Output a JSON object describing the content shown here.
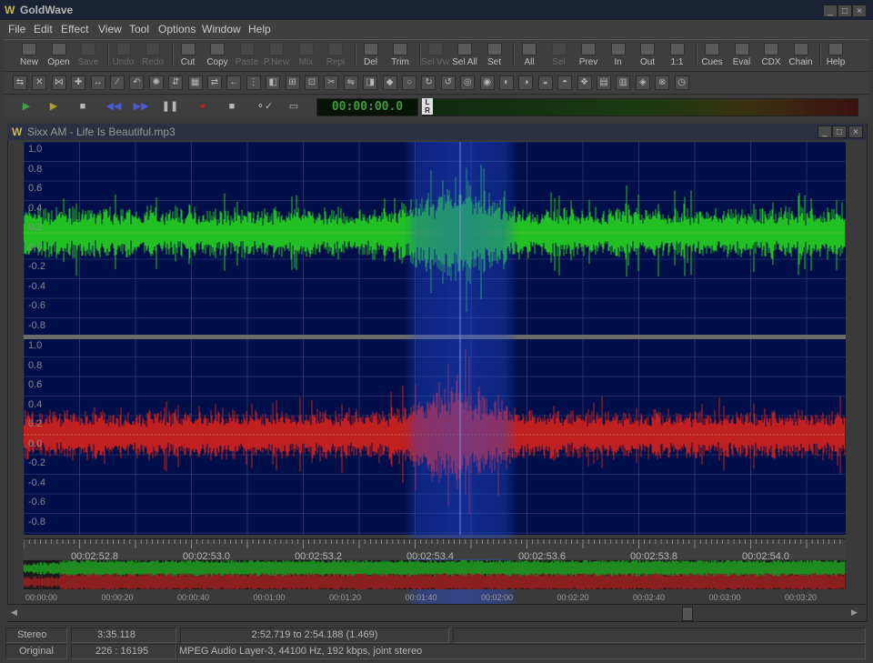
{
  "app": {
    "title": "GoldWave"
  },
  "menu": [
    "File",
    "Edit",
    "Effect",
    "View",
    "Tool",
    "Options",
    "Window",
    "Help"
  ],
  "toolbar": [
    {
      "label": "New",
      "enabled": true
    },
    {
      "label": "Open",
      "enabled": true
    },
    {
      "label": "Save",
      "enabled": false
    },
    {
      "label": "Undo",
      "enabled": false
    },
    {
      "label": "Redo",
      "enabled": false
    },
    {
      "label": "Cut",
      "enabled": true
    },
    {
      "label": "Copy",
      "enabled": true
    },
    {
      "label": "Paste",
      "enabled": false
    },
    {
      "label": "P.New",
      "enabled": false
    },
    {
      "label": "Mix",
      "enabled": false
    },
    {
      "label": "Repl",
      "enabled": false
    },
    {
      "label": "Del",
      "enabled": true
    },
    {
      "label": "Trim",
      "enabled": true
    },
    {
      "label": "Sel Vw",
      "enabled": false
    },
    {
      "label": "Sel All",
      "enabled": true
    },
    {
      "label": "Set",
      "enabled": true
    },
    {
      "label": "All",
      "enabled": true
    },
    {
      "label": "Sel",
      "enabled": false
    },
    {
      "label": "Prev",
      "enabled": true
    },
    {
      "label": "In",
      "enabled": true
    },
    {
      "label": "Out",
      "enabled": true
    },
    {
      "label": "1:1",
      "enabled": true
    },
    {
      "label": "Cues",
      "enabled": true
    },
    {
      "label": "Eval",
      "enabled": true
    },
    {
      "label": "CDX",
      "enabled": true
    },
    {
      "label": "Chain",
      "enabled": true
    },
    {
      "label": "Help",
      "enabled": true
    }
  ],
  "transport": {
    "time": "00:00:00.0",
    "meter_lr": [
      "L",
      "R"
    ]
  },
  "document": {
    "title": "Sixx AM - Life Is Beautiful.mp3"
  },
  "amplitude_labels_top": [
    "1.0",
    "0.8",
    "0.6",
    "0.4",
    "0.2",
    "0.0",
    "-0.2",
    "-0.4",
    "-0.6",
    "-0.8"
  ],
  "amplitude_labels_bottom": [
    "1.0",
    "0.8",
    "0.6",
    "0.4",
    "0.2",
    "0.0",
    "-0.2",
    "-0.4",
    "-0.6",
    "-0.8"
  ],
  "time_ruler": [
    "00:02:52.8",
    "00:02:53.0",
    "00:02:53.2",
    "00:02:53.4",
    "00:02:53.6",
    "00:02:53.8",
    "00:02:54.0"
  ],
  "overview_ruler": [
    "00:00:00",
    "00:00:20",
    "00:00:40",
    "00:01:00",
    "00:01:20",
    "00:01:40",
    "00:02:00",
    "00:02:20",
    "00:02:40",
    "00:03:00",
    "00:03:20"
  ],
  "status": {
    "channels": "Stereo",
    "length": "3:35.118",
    "selection": "2:52.719 to 2:54.188 (1.469)",
    "mode": "Original",
    "zoom": "226 : 16195",
    "format": "MPEG Audio Layer-3, 44100 Hz, 192 kbps, joint stereo"
  },
  "colors": {
    "left_channel": "#22c022",
    "right_channel": "#c02020",
    "background": "#000e4a"
  }
}
